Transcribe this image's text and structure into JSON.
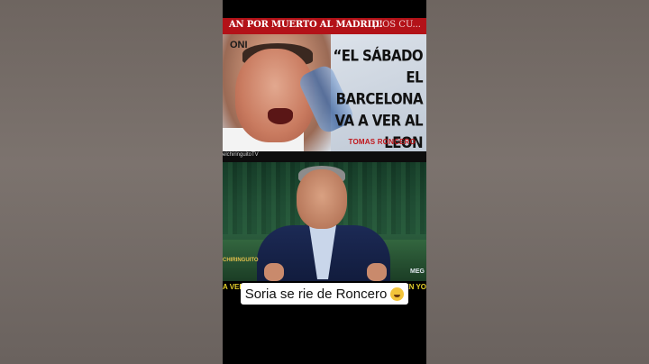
{
  "top_clip": {
    "banner_left": "AN POR MUERTO AL MADRID!",
    "banner_right": "¡LOS CU...",
    "channel_logo": "ONI",
    "quote": "“EL SÁBADO EL BARCELONA VA A VER AL LEON BLANCO”.",
    "quote_author": "TOMAS RONCERO"
  },
  "bottom_clip": {
    "handle": "elchiringuitoTV",
    "brand_left": "CHIRINGUITO",
    "brand_right": "MEG",
    "ticker_left": "A VER",
    "ticker_right": "EN YO"
  },
  "caption": {
    "text": "Soria se rie de Roncero",
    "emoji": "laughing-emoji"
  },
  "colors": {
    "banner_red": "#b31218",
    "author_red": "#c0161b",
    "ticker_yellow": "#e6d02b"
  }
}
